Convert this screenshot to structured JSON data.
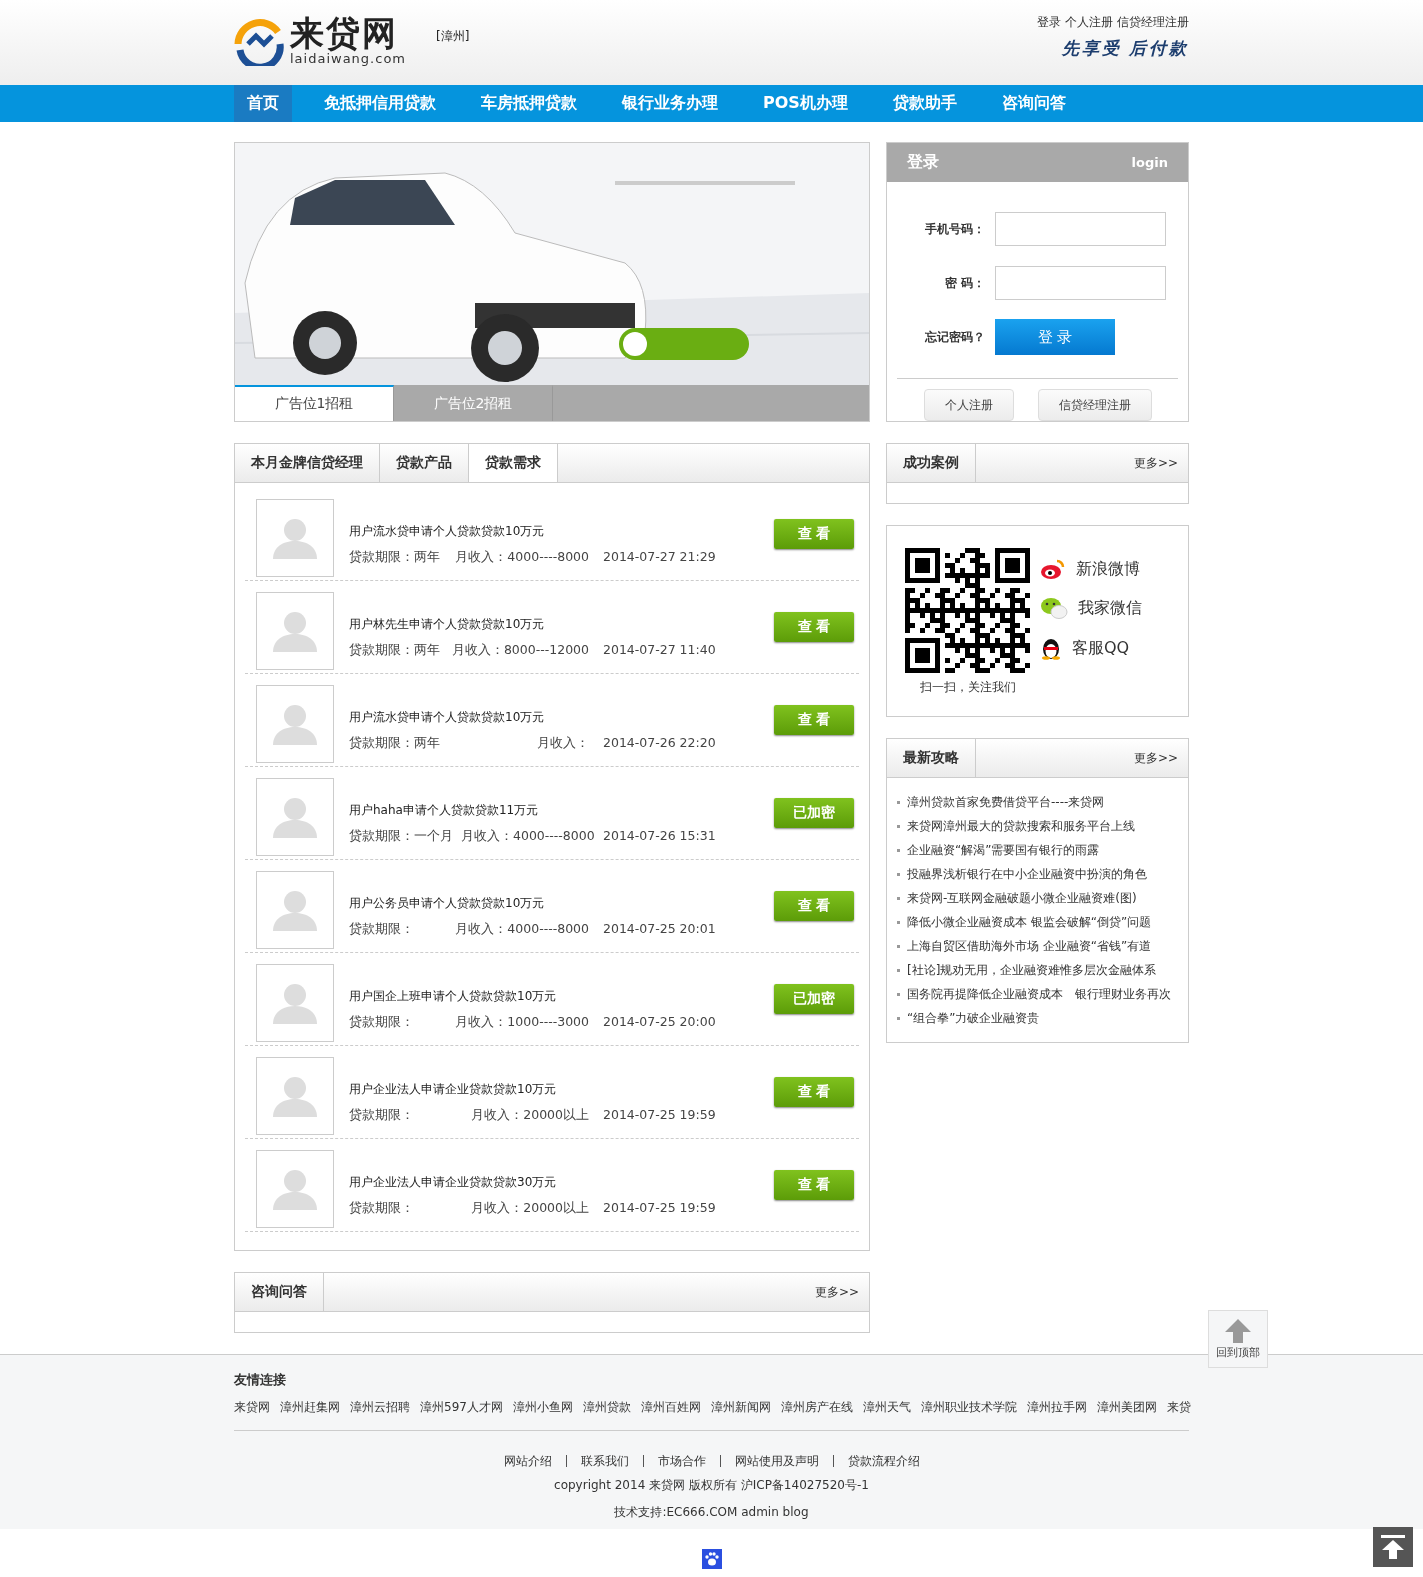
{
  "header": {
    "logo_name": "来贷网",
    "logo_domain": "laidaiwang.com",
    "city": "[漳州]",
    "top_links": [
      "登录",
      "个人注册",
      "信贷经理注册"
    ],
    "slogan": "先享受 后付款"
  },
  "nav": [
    {
      "label": "首页",
      "selected": true
    },
    {
      "label": "免抵押信用贷款",
      "selected": false
    },
    {
      "label": "车房抵押贷款",
      "selected": false
    },
    {
      "label": "银行业务办理",
      "selected": false
    },
    {
      "label": "POS机办理",
      "selected": false
    },
    {
      "label": "贷款助手",
      "selected": false
    },
    {
      "label": "咨询问答",
      "selected": false
    }
  ],
  "banner": {
    "kind": "picture",
    "tabs": [
      {
        "label": "广告位1招租",
        "selected": true
      },
      {
        "label": "广告位2招租",
        "selected": false
      }
    ]
  },
  "login": {
    "title": "登录",
    "subtitle": "login",
    "fields": [
      "手机号码：",
      "密 码："
    ],
    "forgot": "忘记密码？",
    "submit": "登 录",
    "register_buttons": [
      "个人注册",
      "信贷经理注册"
    ]
  },
  "loan_panel": {
    "tabs": [
      {
        "label": "本月金牌信贷经理",
        "selected": false
      },
      {
        "label": "贷款产品",
        "selected": false
      },
      {
        "label": "贷款需求",
        "selected": true
      }
    ],
    "rows": [
      {
        "title": "用户流水贷申请个人贷款贷款10万元",
        "term": "贷款期限：两年",
        "income": "月收入：4000----8000",
        "time": "2014-07-27 21:29",
        "action": "查 看"
      },
      {
        "title": "用户林先生申请个人贷款贷款10万元",
        "term": "贷款期限：两年",
        "income": "月收入：8000---12000",
        "time": "2014-07-27 11:40",
        "action": "查 看"
      },
      {
        "title": "用户流水贷申请个人贷款贷款10万元",
        "term": "贷款期限：两年",
        "income": "月收入：",
        "time": "2014-07-26 22:20",
        "action": "查 看"
      },
      {
        "title": "用户haha申请个人贷款贷款11万元",
        "term": "贷款期限：一个月",
        "income": "月收入：4000----8000",
        "time": "2014-07-26 15:31",
        "action": "已加密"
      },
      {
        "title": "用户公务员申请个人贷款贷款10万元",
        "term": "贷款期限：",
        "income": "月收入：4000----8000",
        "time": "2014-07-25 20:01",
        "action": "查 看"
      },
      {
        "title": "用户国企上班申请个人贷款贷款10万元",
        "term": "贷款期限：",
        "income": "月收入：1000----3000",
        "time": "2014-07-25 20:00",
        "action": "已加密"
      },
      {
        "title": "用户企业法人申请企业贷款贷款10万元",
        "term": "贷款期限：",
        "income": "月收入：20000以上",
        "time": "2014-07-25 19:59",
        "action": "查 看"
      },
      {
        "title": "用户企业法人申请企业贷款贷款30万元",
        "term": "贷款期限：",
        "income": "月收入：20000以上",
        "time": "2014-07-25 19:59",
        "action": "查 看"
      }
    ]
  },
  "cases": {
    "title": "成功案例",
    "more": "更多>>"
  },
  "follow": {
    "caption": "扫一扫，关注我们",
    "links": [
      {
        "kind": "weibo",
        "label": "新浪微博"
      },
      {
        "kind": "wechat",
        "label": "我家微信"
      },
      {
        "kind": "qq",
        "label": "客服QQ"
      }
    ]
  },
  "guides": {
    "title": "最新攻略",
    "more": "更多>>",
    "items": [
      "漳州贷款首家免费借贷平台----来贷网",
      "来贷网漳州最大的贷款搜索和服务平台上线",
      "企业融资“解渴”需要国有银行的雨露",
      "投融界浅析银行在中小企业融资中扮演的角色",
      "来贷网-互联网金融破题小微企业融资难(图)",
      "降低小微企业融资成本 银监会破解“倒贷”问题",
      "上海自贸区借助海外市场 企业融资“省钱”有道",
      "[社论]规劝无用，企业融资难惟多层次金融体系",
      "国务院再提降低企业融资成本　银行理财业务再次",
      "“组合拳”力破企业融资贵"
    ]
  },
  "qa": {
    "title": "咨询问答",
    "more": "更多>>"
  },
  "back_to_top": "回到顶部",
  "footer": {
    "links_title": "友情连接",
    "friend_links": [
      "来贷网",
      "漳州赶集网",
      "漳州云招聘",
      "漳州597人才网",
      "漳州小鱼网",
      "漳州贷款",
      "漳州百姓网",
      "漳州新闻网",
      "漳州房产在线",
      "漳州天气",
      "漳州职业技术学院",
      "漳州拉手网",
      "漳州美团网",
      "来贷"
    ],
    "nav": [
      "网站介绍",
      "联系我们",
      "市场合作",
      "网站使用及声明",
      "贷款流程介绍"
    ],
    "copyright": "copyright 2014 来贷网 版权所有 沪ICP备14027520号-1",
    "support": "技术支持:EC666.COM admin blog"
  }
}
